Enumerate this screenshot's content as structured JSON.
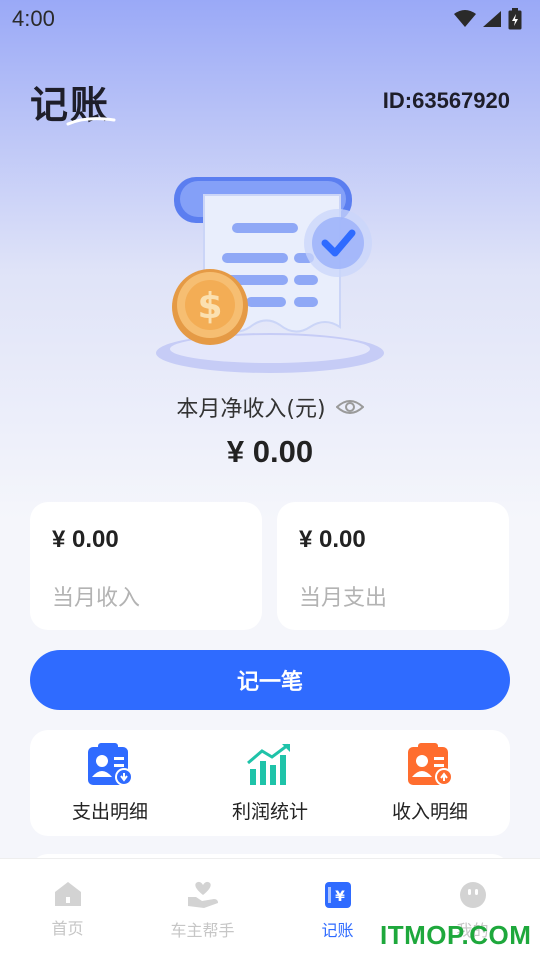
{
  "status_bar": {
    "time": "4:00",
    "icons": [
      "wifi-icon",
      "signal-icon",
      "battery-icon"
    ]
  },
  "header": {
    "title": "记账",
    "user_id": "ID:63567920"
  },
  "summary": {
    "net_income_label": "本月净收入(元)",
    "net_income_value": "¥ 0.00",
    "visibility_icon": "eye-icon"
  },
  "cards": {
    "income": {
      "value": "¥ 0.00",
      "label": "当月收入"
    },
    "expense": {
      "value": "¥ 0.00",
      "label": "当月支出"
    }
  },
  "actions": {
    "record_label": "记一笔"
  },
  "quick_links": [
    {
      "label": "支出明细",
      "icon": "expense-detail-icon",
      "color": "#2f6bff"
    },
    {
      "label": "利润统计",
      "icon": "profit-chart-icon",
      "color": "#1fc3a9"
    },
    {
      "label": "收入明细",
      "icon": "income-detail-icon",
      "color": "#ff6d2e"
    }
  ],
  "tabbar": {
    "tabs": [
      {
        "label": "首页",
        "icon": "home-icon",
        "active": false
      },
      {
        "label": "车主帮手",
        "icon": "helper-icon",
        "active": false
      },
      {
        "label": "记账",
        "icon": "ledger-icon",
        "active": true
      },
      {
        "label": "我的",
        "icon": "profile-icon",
        "active": false
      }
    ]
  },
  "watermark": "ITMOP.COM",
  "colors": {
    "accent": "#2f6bff",
    "background": "#f5f6fb",
    "muted_text": "#b3b3b3"
  }
}
